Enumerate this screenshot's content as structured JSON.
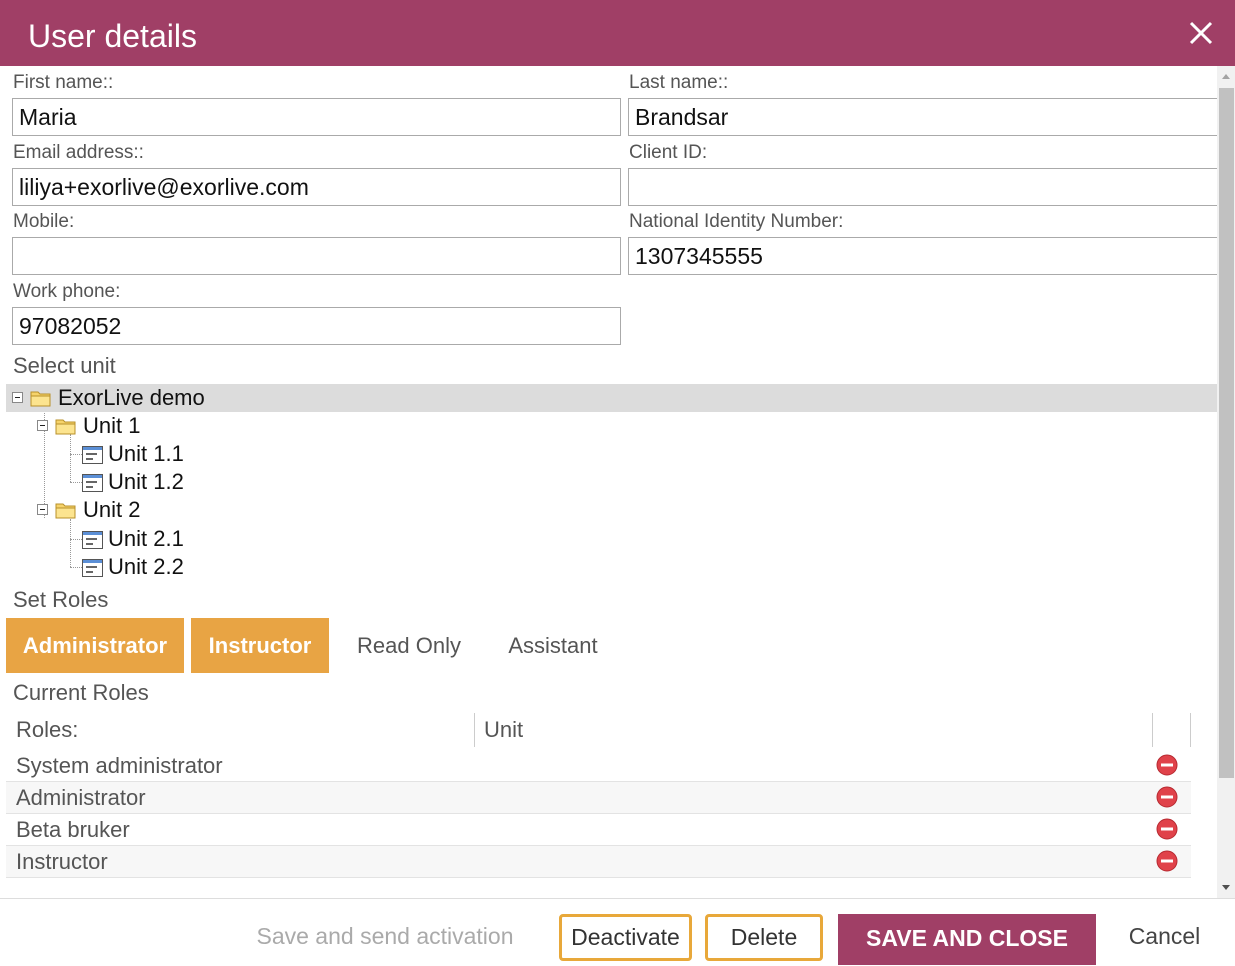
{
  "dialog": {
    "title": "User details"
  },
  "form": {
    "first_name": {
      "label": "First name::",
      "value": "Maria"
    },
    "last_name": {
      "label": "Last name::",
      "value": "Brandsar"
    },
    "email": {
      "label": "Email address::",
      "value": "liliya+exorlive@exorlive.com"
    },
    "client_id": {
      "label": "Client ID:",
      "value": ""
    },
    "mobile": {
      "label": "Mobile:",
      "value": ""
    },
    "national_id": {
      "label": "National Identity Number:",
      "value": "1307345555"
    },
    "work_phone": {
      "label": "Work phone:",
      "value": "97082052"
    }
  },
  "unit_tree": {
    "heading": "Select unit",
    "root": "ExorLive demo",
    "units": [
      {
        "label": "Unit 1",
        "children": [
          "Unit 1.1",
          "Unit 1.2"
        ]
      },
      {
        "label": "Unit 2",
        "children": [
          "Unit 2.1",
          "Unit 2.2"
        ]
      }
    ]
  },
  "set_roles": {
    "heading": "Set Roles",
    "roles": [
      {
        "label": "Administrator",
        "active": true
      },
      {
        "label": "Instructor",
        "active": true
      },
      {
        "label": "Read Only",
        "active": false
      },
      {
        "label": "Assistant",
        "active": false
      }
    ]
  },
  "current_roles": {
    "heading": "Current Roles",
    "columns": [
      "Roles:",
      "Unit"
    ],
    "rows": [
      {
        "role": "System administrator",
        "unit": ""
      },
      {
        "role": "Administrator",
        "unit": ""
      },
      {
        "role": "Beta bruker",
        "unit": ""
      },
      {
        "role": "Instructor",
        "unit": ""
      }
    ]
  },
  "footer": {
    "save_send_activation": "Save and send activation",
    "deactivate": "Deactivate",
    "delete": "Delete",
    "save_close": "SAVE AND CLOSE",
    "cancel": "Cancel"
  },
  "colors": {
    "header": "#a03f66",
    "role_active": "#e8a444",
    "outline_button": "#e8a83a",
    "remove_icon": "#e0424a"
  },
  "icons": {
    "close": "close-icon",
    "folder": "folder-icon",
    "unit": "unit-icon",
    "expander": "collapse-icon",
    "remove": "remove-icon"
  }
}
